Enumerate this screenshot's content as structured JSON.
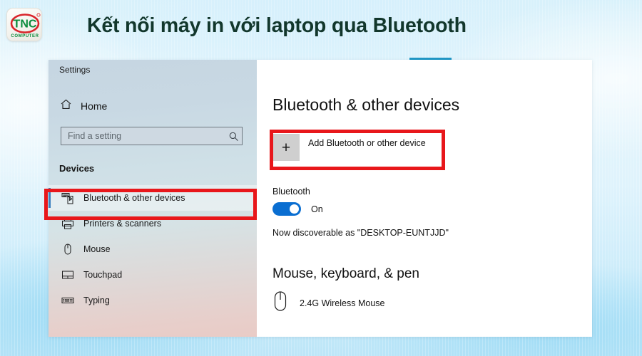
{
  "header": {
    "title": "Kết nối máy in với laptop qua Bluetooth",
    "logo": {
      "name": "tnc-computer-logo",
      "brand_text": "TNC",
      "sub_text": "COMPUTER",
      "green": "#0a8b3c",
      "red": "#d9232a"
    },
    "title_color": "#12372c"
  },
  "window": {
    "accent_color": "#2196c4"
  },
  "sidebar": {
    "title": "Settings",
    "home": {
      "label": "Home",
      "icon": "home-icon"
    },
    "search": {
      "value": "",
      "placeholder": "Find a setting",
      "icon": "search-icon"
    },
    "group_label": "Devices",
    "items": [
      {
        "label": "Bluetooth & other devices",
        "icon": "bluetooth-devices-icon",
        "selected": true
      },
      {
        "label": "Printers & scanners",
        "icon": "printer-icon",
        "selected": false
      },
      {
        "label": "Mouse",
        "icon": "mouse-icon",
        "selected": false
      },
      {
        "label": "Touchpad",
        "icon": "touchpad-icon",
        "selected": false
      },
      {
        "label": "Typing",
        "icon": "keyboard-icon",
        "selected": false
      }
    ],
    "selected_accent": "#3a7fbf"
  },
  "main": {
    "heading": "Bluetooth & other devices",
    "add_device": {
      "label": "Add Bluetooth or other device",
      "plus_glyph": "+"
    },
    "bluetooth": {
      "label": "Bluetooth",
      "state": "On",
      "toggle_on": true,
      "toggle_color": "#0a6ed1",
      "discoverable": "Now discoverable as \"DESKTOP-EUNTJJD\""
    },
    "peripherals": {
      "heading": "Mouse, keyboard, & pen",
      "devices": [
        {
          "label": "2.4G Wireless Mouse",
          "icon": "mouse-icon"
        }
      ]
    }
  },
  "annotations": {
    "color": "#e8171b",
    "boxes": [
      {
        "name": "highlight-sidebar-bluetooth"
      },
      {
        "name": "highlight-add-device-button"
      }
    ]
  }
}
